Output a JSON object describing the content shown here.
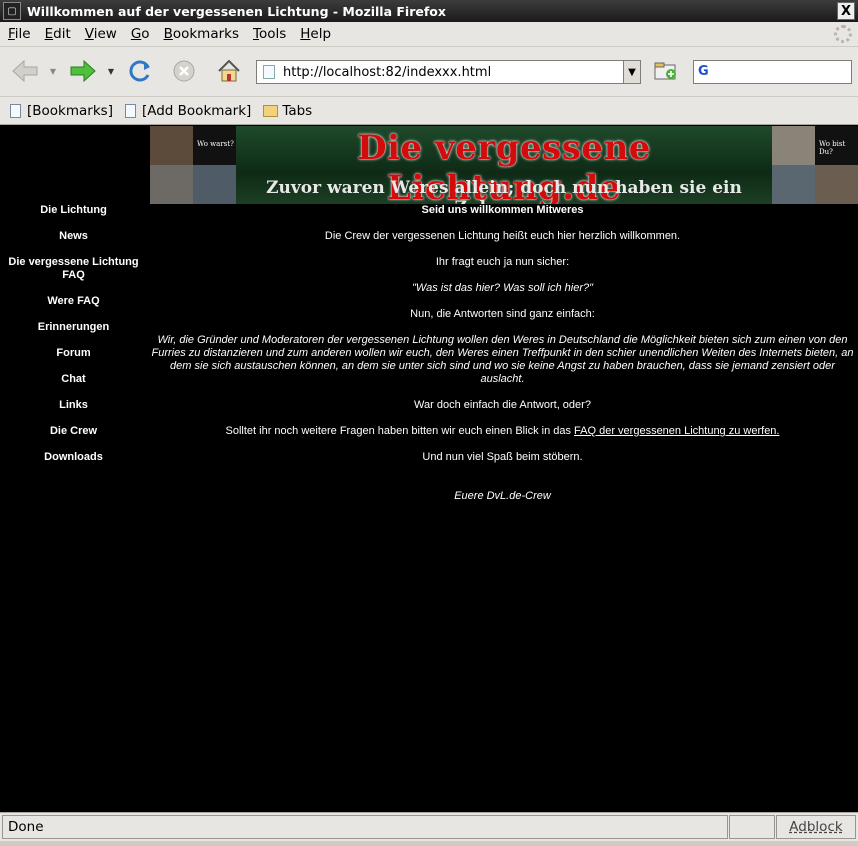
{
  "window": {
    "title": "Willkommen auf der vergessenen Lichtung - Mozilla Firefox",
    "close_glyph": "X"
  },
  "menu": [
    "File",
    "Edit",
    "View",
    "Go",
    "Bookmarks",
    "Tools",
    "Help"
  ],
  "toolbar": {
    "url": "http://localhost:82/indexxx.html",
    "search_engine_glyph": "G",
    "search_value": ""
  },
  "bookmarks": [
    {
      "label": "[Bookmarks]",
      "icon": "page-icon"
    },
    {
      "label": "[Add Bookmark]",
      "icon": "page-icon"
    },
    {
      "label": "Tabs",
      "icon": "folder-icon"
    }
  ],
  "banner": {
    "title": "Die vergessene Lichtung.de",
    "subtitle": "Zuvor waren Weres allein; doch nun haben sie ein Zuhause...",
    "left_caption": "Wo warst?",
    "right_caption": "Wo bist Du?"
  },
  "sidebar": [
    "Die Lichtung",
    "News",
    "Die vergessene Lichtung FAQ",
    "Were FAQ",
    "Erinnerungen",
    "Forum",
    "Chat",
    "Links",
    "Die Crew",
    "Downloads"
  ],
  "main": {
    "heading": "Seid uns willkommen Mitweres",
    "p1": "Die Crew der vergessenen Lichtung heißt euch hier herzlich willkommen.",
    "p2": "Ihr fragt euch ja nun sicher:",
    "p3": "\"Was ist das hier? Was soll ich hier?\"",
    "p4": "Nun, die Antworten sind ganz einfach:",
    "p5": "Wir, die Gründer und Moderatoren der vergessenen Lichtung wollen den Weres in Deutschland die Möglichkeit bieten sich zum einen von den Furries zu distanzieren und zum anderen wollen wir euch, den Weres einen Treffpunkt in den schier unendlichen Weiten des Internets bieten, an dem sie sich austauschen können, an dem sie unter sich sind und wo sie keine Angst zu haben brauchen, dass sie jemand zensiert oder auslacht.",
    "p6": "War doch einfach die Antwort, oder?",
    "p7_prefix": "Solltet ihr noch weitere Fragen haben bitten wir euch einen Blick in das ",
    "p7_link": "FAQ der vergessenen Lichtung zu werfen.",
    "p8": "Und nun viel Spaß beim stöbern.",
    "signature": "Euere DvL.de-Crew"
  },
  "status": {
    "text": "Done",
    "adblock": "Adblock"
  },
  "colors": {
    "page_bg": "#000000",
    "chrome_bg": "#e8e6e2",
    "banner_red": "#d40b0b",
    "banner_green": "#173a22"
  }
}
